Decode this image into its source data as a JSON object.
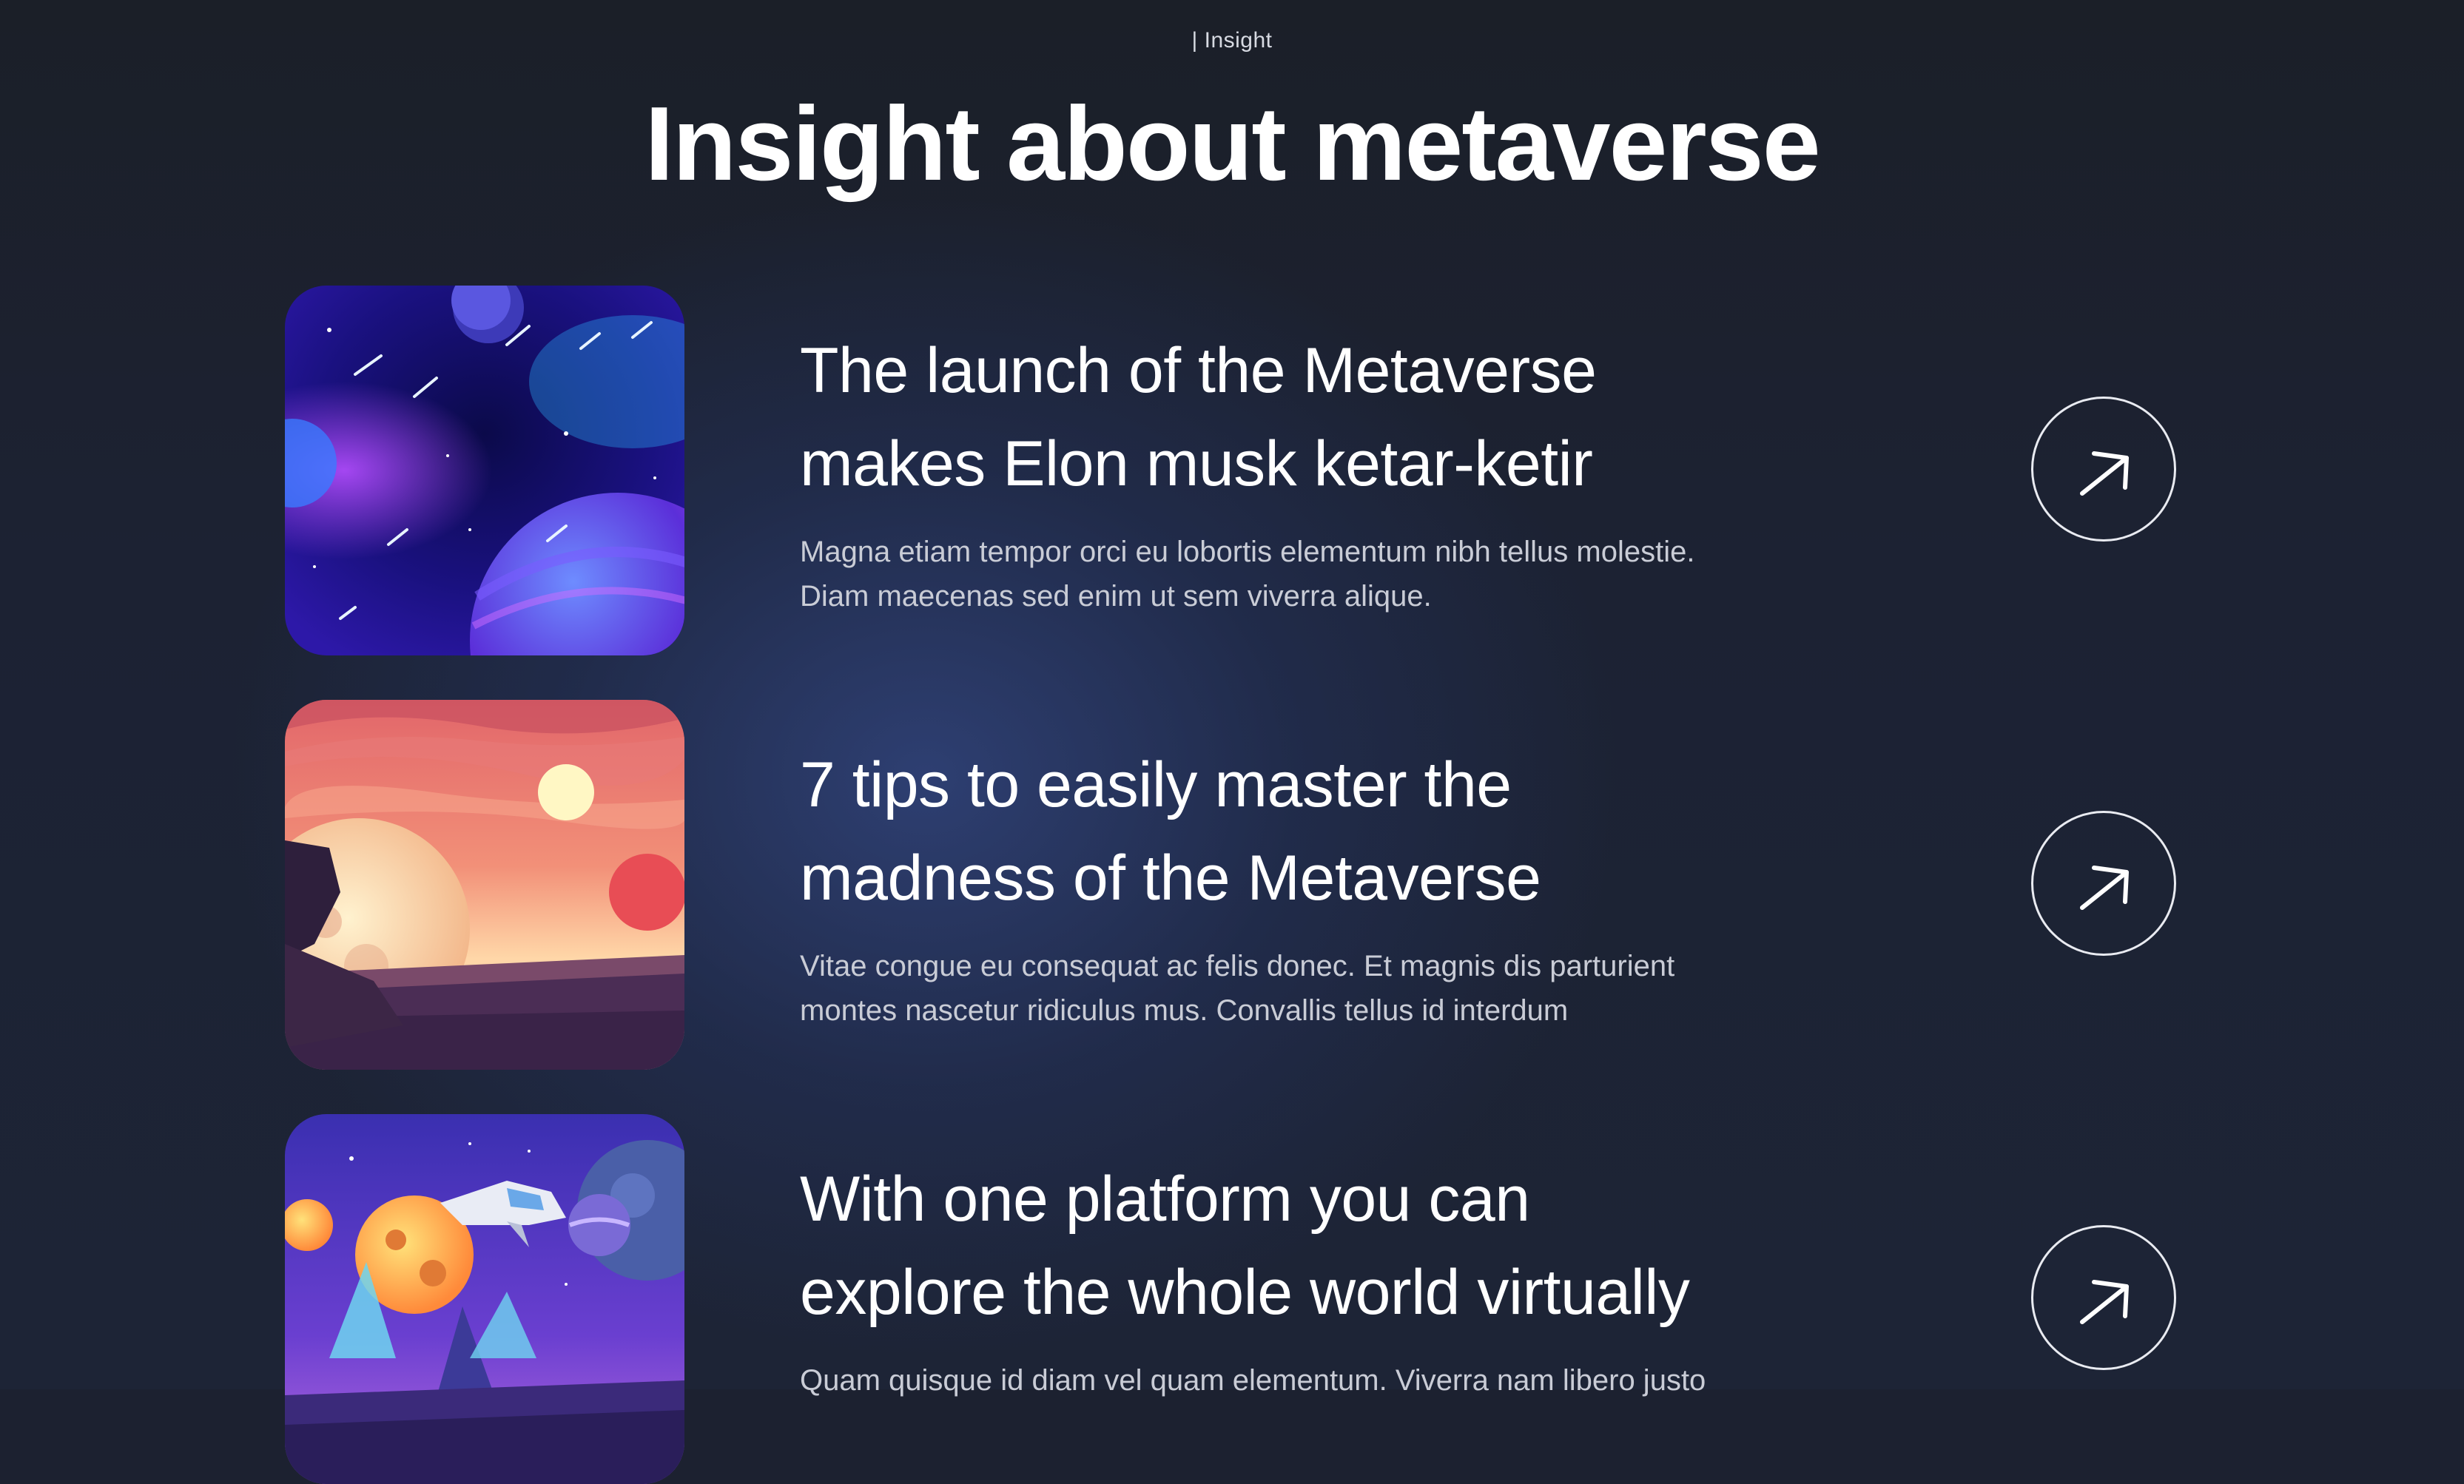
{
  "section": {
    "eyebrow": "| Insight",
    "title": "Insight about metaverse"
  },
  "articles": [
    {
      "title_line1": "The launch of the Metaverse",
      "title_line2": "makes Elon musk ketar-ketir",
      "desc_line1": "Magna etiam tempor orci eu lobortis elementum nibh tellus molestie.",
      "desc_line2": "Diam maecenas sed enim ut sem viverra alique.",
      "image": "space-planets-illustration"
    },
    {
      "title_line1": "7 tips to easily master the",
      "title_line2": "madness of the Metaverse",
      "desc_line1": "Vitae congue eu consequat ac felis donec. Et magnis dis parturient",
      "desc_line2": "montes nascetur ridiculus mus. Convallis tellus id interdum",
      "image": "alien-sunset-illustration"
    },
    {
      "title_line1": "With one platform you can",
      "title_line2": "explore the whole world virtually",
      "desc_line1": "Quam quisque id diam vel quam elementum. Viverra nam libero justo",
      "desc_line2": "",
      "image": "spaceship-planets-illustration"
    }
  ],
  "icons": {
    "read_more": "arrow-up-right-icon"
  },
  "colors": {
    "background": "#1c2130",
    "glow": "#31447d",
    "text": "#ffffff",
    "muted_text": "#c9ccd6"
  }
}
